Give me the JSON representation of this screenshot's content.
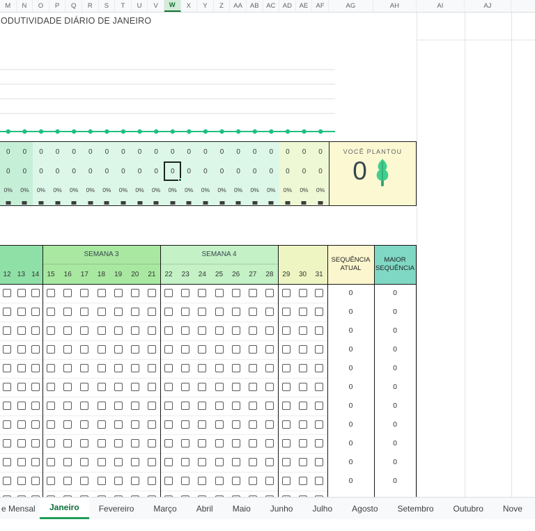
{
  "column_header_row": {
    "letters": [
      "M",
      "N",
      "O",
      "P",
      "Q",
      "R",
      "S",
      "T",
      "U",
      "V",
      "W",
      "X",
      "Y",
      "Z",
      "AA",
      "AB",
      "AC",
      "AD",
      "AE",
      "AF",
      "AG",
      "AH",
      "AI",
      "AJ"
    ],
    "selected_letter": "W"
  },
  "sheet_title": "ODUTIVIDADE DIÁRIO DE JANEIRO",
  "chart_data": {
    "type": "line",
    "values": [
      0,
      0,
      0,
      0,
      0,
      0,
      0,
      0,
      0,
      0,
      0,
      0,
      0,
      0,
      0,
      0,
      0,
      0,
      0,
      0
    ],
    "title": "",
    "xlabel": "",
    "ylabel": "",
    "x_tick_labels_visible": false,
    "grid": true,
    "legend": false
  },
  "stats_grid": {
    "rows": [
      [
        "0",
        "0",
        "0",
        "0",
        "0",
        "0",
        "0",
        "0",
        "0",
        "0",
        "0",
        "0",
        "0",
        "0",
        "0",
        "0",
        "0",
        "0",
        "0",
        "0"
      ],
      [
        "0",
        "0",
        "0",
        "0",
        "0",
        "0",
        "0",
        "0",
        "0",
        "0",
        "0",
        "0",
        "0",
        "0",
        "0",
        "0",
        "0",
        "0",
        "0",
        "0"
      ],
      [
        "0%",
        "0%",
        "0%",
        "0%",
        "0%",
        "0%",
        "0%",
        "0%",
        "0%",
        "0%",
        "0%",
        "0%",
        "0%",
        "0%",
        "0%",
        "0%",
        "0%",
        "0%",
        "0%",
        "0%"
      ]
    ],
    "selected": {
      "row_index": 1,
      "col_index": 10,
      "column_letter": "W",
      "value": "0"
    }
  },
  "planted": {
    "label": "VOCÊ PLANTOU",
    "value": "0"
  },
  "tracker": {
    "groups": [
      {
        "label": "",
        "days": [
          "12",
          "13",
          "14"
        ]
      },
      {
        "label": "SEMANA 3",
        "days": [
          "15",
          "16",
          "17",
          "18",
          "19",
          "20",
          "21"
        ]
      },
      {
        "label": "SEMANA 4",
        "days": [
          "22",
          "23",
          "24",
          "25",
          "26",
          "27",
          "28"
        ]
      },
      {
        "label": "",
        "days": [
          "29",
          "30",
          "31"
        ]
      }
    ],
    "current_streak_header": "SEQUÊNCIA ATUAL",
    "max_streak_header": "MAIOR SEQUÊNCIA",
    "row_count": 12,
    "current_streak_values": [
      "0",
      "0",
      "0",
      "0",
      "0",
      "0",
      "0",
      "0",
      "0",
      "0",
      "0",
      ""
    ],
    "max_streak_values": [
      "0",
      "0",
      "0",
      "0",
      "0",
      "0",
      "0",
      "0",
      "0",
      "0",
      "0",
      ""
    ],
    "checkbox_state": "unchecked"
  },
  "sheet_tabs": {
    "items": [
      {
        "label": "e Mensal",
        "active": false
      },
      {
        "label": "Janeiro",
        "active": true
      },
      {
        "label": "Fevereiro",
        "active": false
      },
      {
        "label": "Março",
        "active": false
      },
      {
        "label": "Abril",
        "active": false
      },
      {
        "label": "Maio",
        "active": false
      },
      {
        "label": "Junho",
        "active": false
      },
      {
        "label": "Julho",
        "active": false
      },
      {
        "label": "Agosto",
        "active": false
      },
      {
        "label": "Setembro",
        "active": false
      },
      {
        "label": "Outubro",
        "active": false
      },
      {
        "label": "Nove",
        "active": false
      }
    ]
  },
  "colors": {
    "accent_green": "#1e9e57",
    "selected_col_text": "#137333",
    "chart_line": "#1fbf82",
    "stats_mint_dark": "#c5efd7",
    "stats_mint": "#dcf7e8",
    "stats_pale": "#eff8d4",
    "planted_bg": "#fcf8d2",
    "week_left_header": "#8fe0a6",
    "week3_header": "#a9e8a1",
    "week4_header": "#c4f1c6",
    "days_29_31_header": "#eef5c3",
    "current_streak_bg": "#fbf6cd",
    "max_streak_bg": "#7fd8c4",
    "tree_green": "#3fcf8e",
    "tree_dark": "#2e9e68"
  }
}
